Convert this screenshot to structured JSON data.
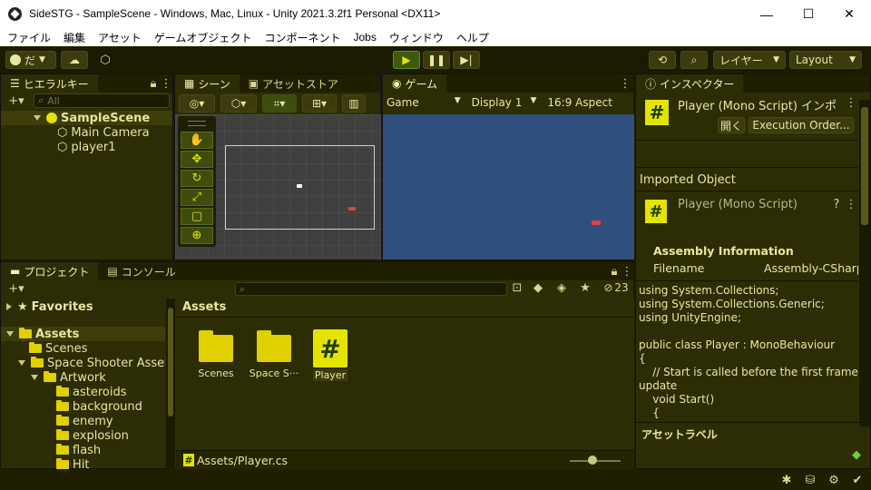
{
  "window": {
    "title": "SideSTG - SampleScene - Windows, Mac, Linux - Unity 2021.3.2f1 Personal <DX11>",
    "minimize": "—",
    "maximize": "☐",
    "close": "✕"
  },
  "menu": [
    "ファイル",
    "編集",
    "アセット",
    "ゲームオブジェクト",
    "コンポーネント",
    "Jobs",
    "ウィンドウ",
    "ヘルプ"
  ],
  "toolbar": {
    "account": "だ",
    "layers": "レイヤー",
    "layout": "Layout"
  },
  "hierarchy": {
    "tab": "ヒエラルキー",
    "search_placeholder": "All",
    "scene": "SampleScene",
    "objects": [
      "Main Camera",
      "player1"
    ]
  },
  "scene_view": {
    "tab": "シーン",
    "asset_store_tab": "アセットストア"
  },
  "game_view": {
    "tab": "ゲーム",
    "display_mode": "Game",
    "display": "Display 1",
    "aspect": "16:9 Aspect"
  },
  "inspector": {
    "tab": "インスペクター",
    "header_title": "Player (Mono Script) インポ",
    "open_button": "開く",
    "execution_order_button": "Execution Order...",
    "imported_object": "Imported Object",
    "script_title": "Player (Mono Script)",
    "assembly_info": "Assembly Information",
    "filename_label": "Filename",
    "filename_value": "Assembly-CSharp",
    "code": "using System.Collections;\nusing System.Collections.Generic;\nusing UnityEngine;\n\npublic class Player : MonoBehaviour\n{\n    // Start is called before the first frame\nupdate\n    void Start()\n    {",
    "asset_labels": "アセットラベル"
  },
  "project": {
    "tab": "プロジェクト",
    "console_tab": "コンソール",
    "hidden_count": "23",
    "favorites": "Favorites",
    "assets": "Assets",
    "tree": [
      "Scenes",
      "Space Shooter Assets",
      "Artwork",
      "asteroids",
      "background",
      "enemy",
      "explosion",
      "flash",
      "Hit"
    ],
    "breadcrumb": "Assets",
    "grid_items": [
      "Scenes",
      "Space S···",
      "Player"
    ],
    "selected_path": "Assets/Player.cs"
  },
  "colors": {
    "accent": "#e4e400",
    "scene_bg": "#404040",
    "game_bg": "#2f4f7f",
    "panel": "#2d2d05"
  }
}
